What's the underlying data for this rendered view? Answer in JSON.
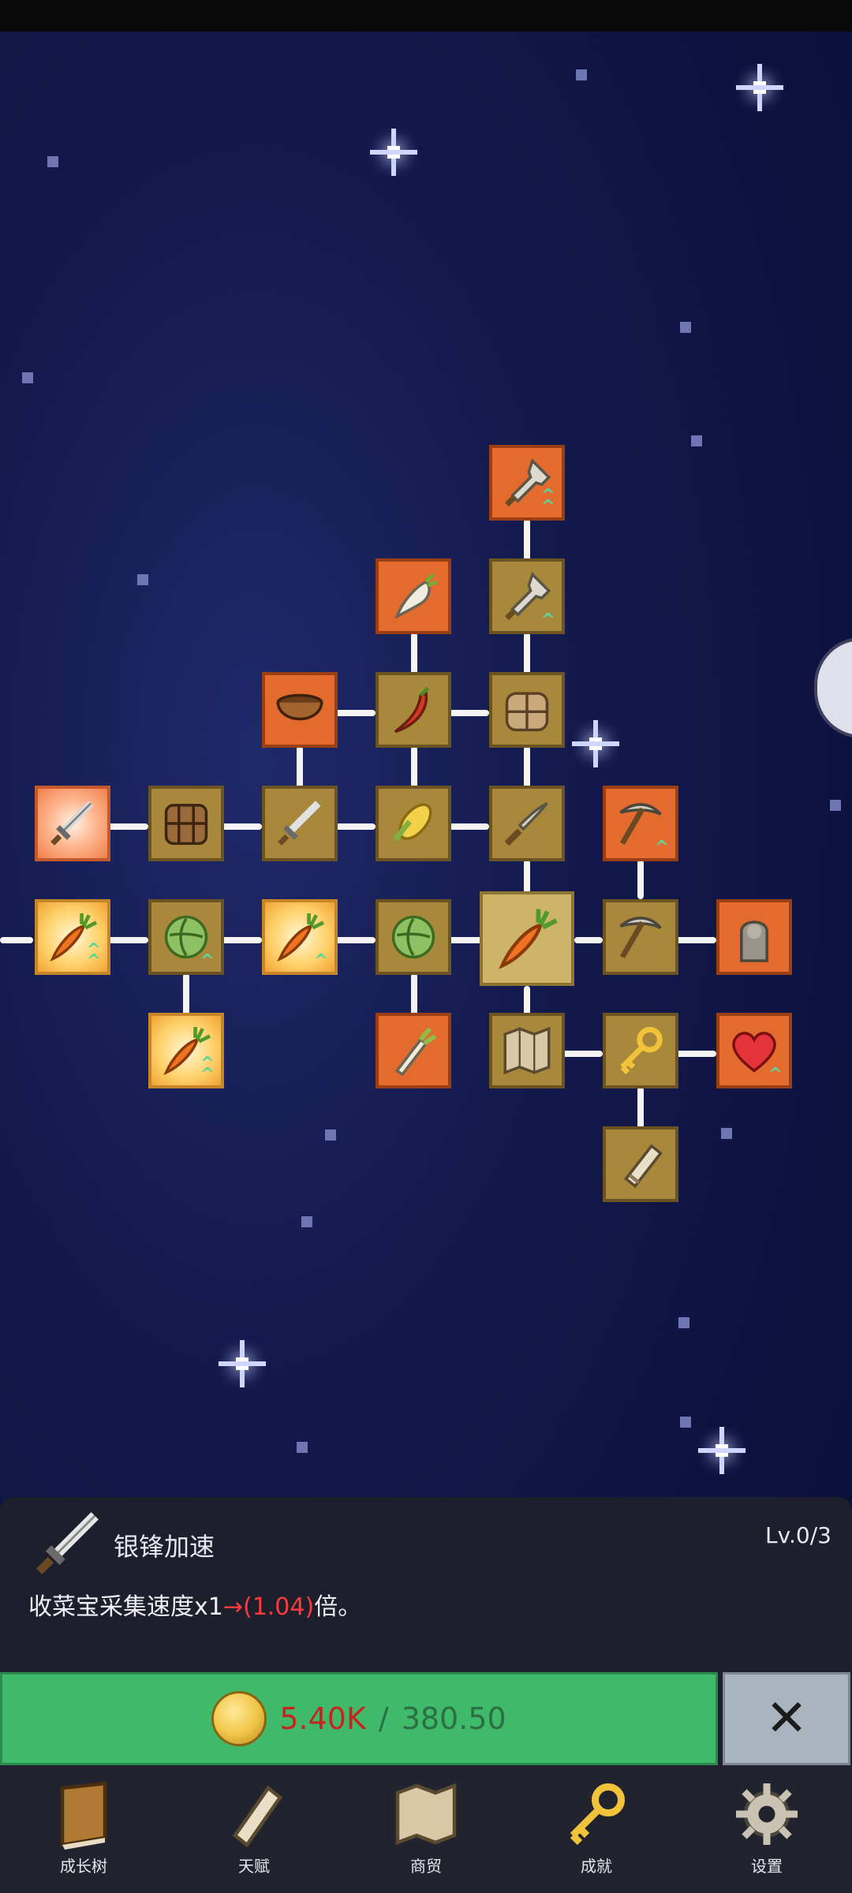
{
  "skill_tree": {
    "nodes": [
      {
        "id": "shovel-2",
        "icon": "shovel-icon",
        "style": "orange",
        "upgrade": true
      },
      {
        "id": "radish",
        "icon": "radish-icon",
        "style": "orange",
        "upgrade": false
      },
      {
        "id": "shovel-1",
        "icon": "shovel-icon",
        "style": "olive",
        "upgrade": true
      },
      {
        "id": "bowl",
        "icon": "bowl-icon",
        "style": "orange",
        "upgrade": false
      },
      {
        "id": "chili",
        "icon": "chili-icon",
        "style": "olive",
        "upgrade": false
      },
      {
        "id": "basket-top",
        "icon": "basket-icon",
        "style": "olive",
        "upgrade": false
      },
      {
        "id": "silver-sword",
        "icon": "sword-icon",
        "style": "sunburst",
        "upgrade": false
      },
      {
        "id": "basket-left",
        "icon": "basket-icon",
        "style": "olive",
        "upgrade": false
      },
      {
        "id": "sword",
        "icon": "sword-icon",
        "style": "olive",
        "upgrade": false
      },
      {
        "id": "corn",
        "icon": "corn-icon",
        "style": "olive",
        "upgrade": false
      },
      {
        "id": "knife",
        "icon": "knife-icon",
        "style": "olive",
        "upgrade": false
      },
      {
        "id": "pickaxe-orange",
        "icon": "pickaxe-icon",
        "style": "orange",
        "upgrade": true
      },
      {
        "id": "carrot-glow-1",
        "icon": "carrot-icon",
        "style": "glow",
        "upgrade": true
      },
      {
        "id": "cabbage-1",
        "icon": "cabbage-icon",
        "style": "olive",
        "upgrade": true
      },
      {
        "id": "carrot-glow-2",
        "icon": "carrot-icon",
        "style": "glow",
        "upgrade": true
      },
      {
        "id": "cabbage-2",
        "icon": "cabbage-icon",
        "style": "olive",
        "upgrade": false
      },
      {
        "id": "carrot-center",
        "icon": "carrot-icon",
        "style": "selected",
        "upgrade": false
      },
      {
        "id": "pickaxe",
        "icon": "pickaxe-icon",
        "style": "olive",
        "upgrade": false
      },
      {
        "id": "statue",
        "icon": "statue-icon",
        "style": "orange",
        "upgrade": false
      },
      {
        "id": "carrot-glow-3",
        "icon": "carrot-icon",
        "style": "glow",
        "upgrade": true
      },
      {
        "id": "leek",
        "icon": "leek-icon",
        "style": "orange",
        "upgrade": false
      },
      {
        "id": "map",
        "icon": "map-icon",
        "style": "olive",
        "upgrade": false
      },
      {
        "id": "key",
        "icon": "key-icon",
        "style": "olive",
        "upgrade": false
      },
      {
        "id": "heart",
        "icon": "heart-icon",
        "style": "orange",
        "upgrade": true
      },
      {
        "id": "scroll",
        "icon": "scroll-icon",
        "style": "olive",
        "upgrade": false
      }
    ]
  },
  "detail": {
    "icon": "sword-icon",
    "title": "银锋加速",
    "level": "Lv.0/3",
    "desc_prefix": "收菜宝采集速度x1",
    "desc_arrow": "→",
    "desc_value": "(1.04)",
    "desc_suffix": "倍。"
  },
  "purchase": {
    "coin_icon": "coin-icon",
    "have": "5.40K",
    "separator": "/",
    "need": "380.50",
    "close_icon": "close-icon"
  },
  "nav": [
    {
      "label": "成长树",
      "icon": "book-icon"
    },
    {
      "label": "天赋",
      "icon": "scroll-icon"
    },
    {
      "label": "商贸",
      "icon": "map-icon"
    },
    {
      "label": "成就",
      "icon": "key-icon"
    },
    {
      "label": "设置",
      "icon": "gear-icon"
    }
  ],
  "colors": {
    "orange_tile": "#e36b2d",
    "olive_tile": "#a8883a",
    "buy_button": "#3fba6a",
    "price_have": "#c8231f",
    "price_need": "#2d6f45"
  }
}
